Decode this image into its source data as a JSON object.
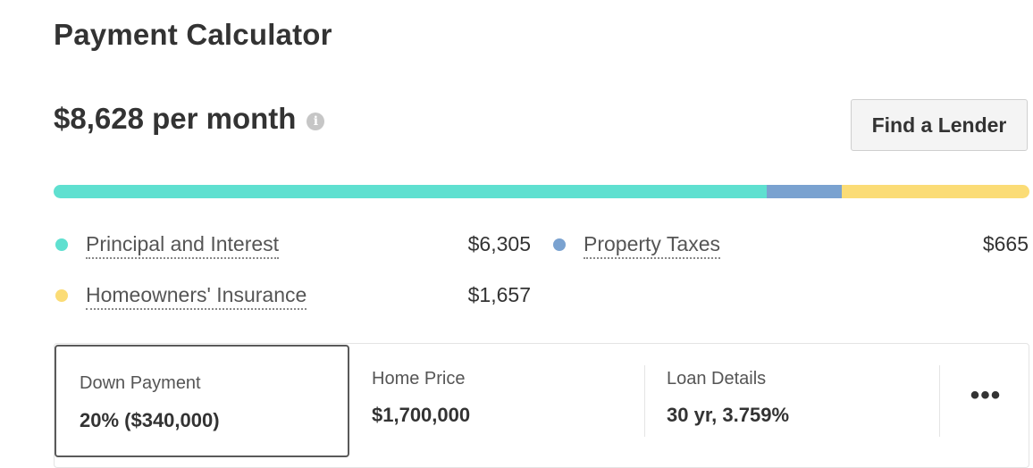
{
  "header": {
    "title": "Payment Calculator"
  },
  "monthly": {
    "amount": "$8,628 per month",
    "info_icon": "info-icon"
  },
  "actions": {
    "find_lender": "Find a Lender"
  },
  "breakdown": {
    "bar": [
      {
        "name": "Principal and Interest",
        "value": 6305,
        "color": "#5fe0d0"
      },
      {
        "name": "Property Taxes",
        "value": 665,
        "color": "#7aa2d0"
      },
      {
        "name": "Homeowners' Insurance",
        "value": 1657,
        "color": "#fbdc76"
      }
    ],
    "items": [
      {
        "label": "Principal and Interest",
        "value": "$6,305",
        "color": "#5fe0d0"
      },
      {
        "label": "Property Taxes",
        "value": "$665",
        "color": "#7aa2d0"
      },
      {
        "label": "Homeowners' Insurance",
        "value": "$1,657",
        "color": "#fbdc76"
      }
    ]
  },
  "params": {
    "down_payment": {
      "label": "Down Payment",
      "value": "20% ($340,000)"
    },
    "home_price": {
      "label": "Home Price",
      "value": "$1,700,000"
    },
    "loan_details": {
      "label": "Loan Details",
      "value": "30 yr, 3.759%"
    },
    "more": {
      "label": "•••",
      "icon": "more-icon"
    }
  }
}
